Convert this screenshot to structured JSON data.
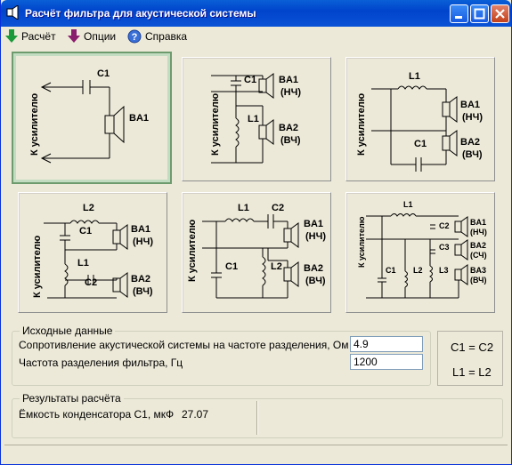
{
  "window": {
    "title": "Расчёт фильтра для акустической системы",
    "icon": "speaker-icon",
    "controls": [
      "minimize",
      "maximize",
      "close"
    ]
  },
  "menu": [
    {
      "label": "Расчёт",
      "icon": "green-arrow-down-icon"
    },
    {
      "label": "Опции",
      "icon": "purple-arrow-down-icon"
    },
    {
      "label": "Справка",
      "icon": "help-icon"
    }
  ],
  "schemes": {
    "amp_label": "К усилителю",
    "s1": {
      "c1": "C1",
      "ba1": "BA1"
    },
    "s2": {
      "c1": "C1",
      "l1": "L1",
      "ba1": "BA1",
      "hf1": "(НЧ)",
      "ba2": "BA2",
      "hf2": "(ВЧ)"
    },
    "s3": {
      "l1": "L1",
      "c1": "C1",
      "ba1": "BA1",
      "hf1": "(НЧ)",
      "ba2": "BA2",
      "hf2": "(ВЧ)"
    },
    "s4": {
      "l2": "L2",
      "c1": "C1",
      "l1": "L1",
      "c2": "C2",
      "ba1": "BA1",
      "hf1": "(НЧ)",
      "ba2": "BA2",
      "hf2": "(ВЧ)"
    },
    "s5": {
      "l1": "L1",
      "c2": "C2",
      "c1": "C1",
      "l2": "L2",
      "ba1": "BA1",
      "hf1": "(НЧ)",
      "ba2": "BA2",
      "hf2": "(ВЧ)"
    },
    "s6": {
      "l1": "L1",
      "c2": "C2",
      "c3": "C3",
      "c1": "C1",
      "l2": "L2",
      "l3": "L3",
      "ba1": "BA1",
      "hf1": "(НЧ)",
      "ba2": "BA2",
      "hf2": "(СЧ)",
      "ba3": "BA3",
      "hf3": "(ВЧ)"
    }
  },
  "input": {
    "title": "Исходные данные",
    "resistance_label": "Сопротивление акустической системы на частоте разделения, Ом",
    "resistance_value": "4.9",
    "frequency_label": "Частота разделения фильтра, Гц",
    "frequency_value": "1200"
  },
  "equalities": {
    "c": "C1 = C2",
    "l": "L1 = L2"
  },
  "results": {
    "title": "Результаты расчёта",
    "capacitance_label": "Ёмкость конденсатора C1, мкФ",
    "capacitance_value": "27.07"
  },
  "colors": {
    "titlebar": "#0054e3",
    "window_bg": "#ece9d8",
    "selected_border": "#6e9b6e"
  }
}
